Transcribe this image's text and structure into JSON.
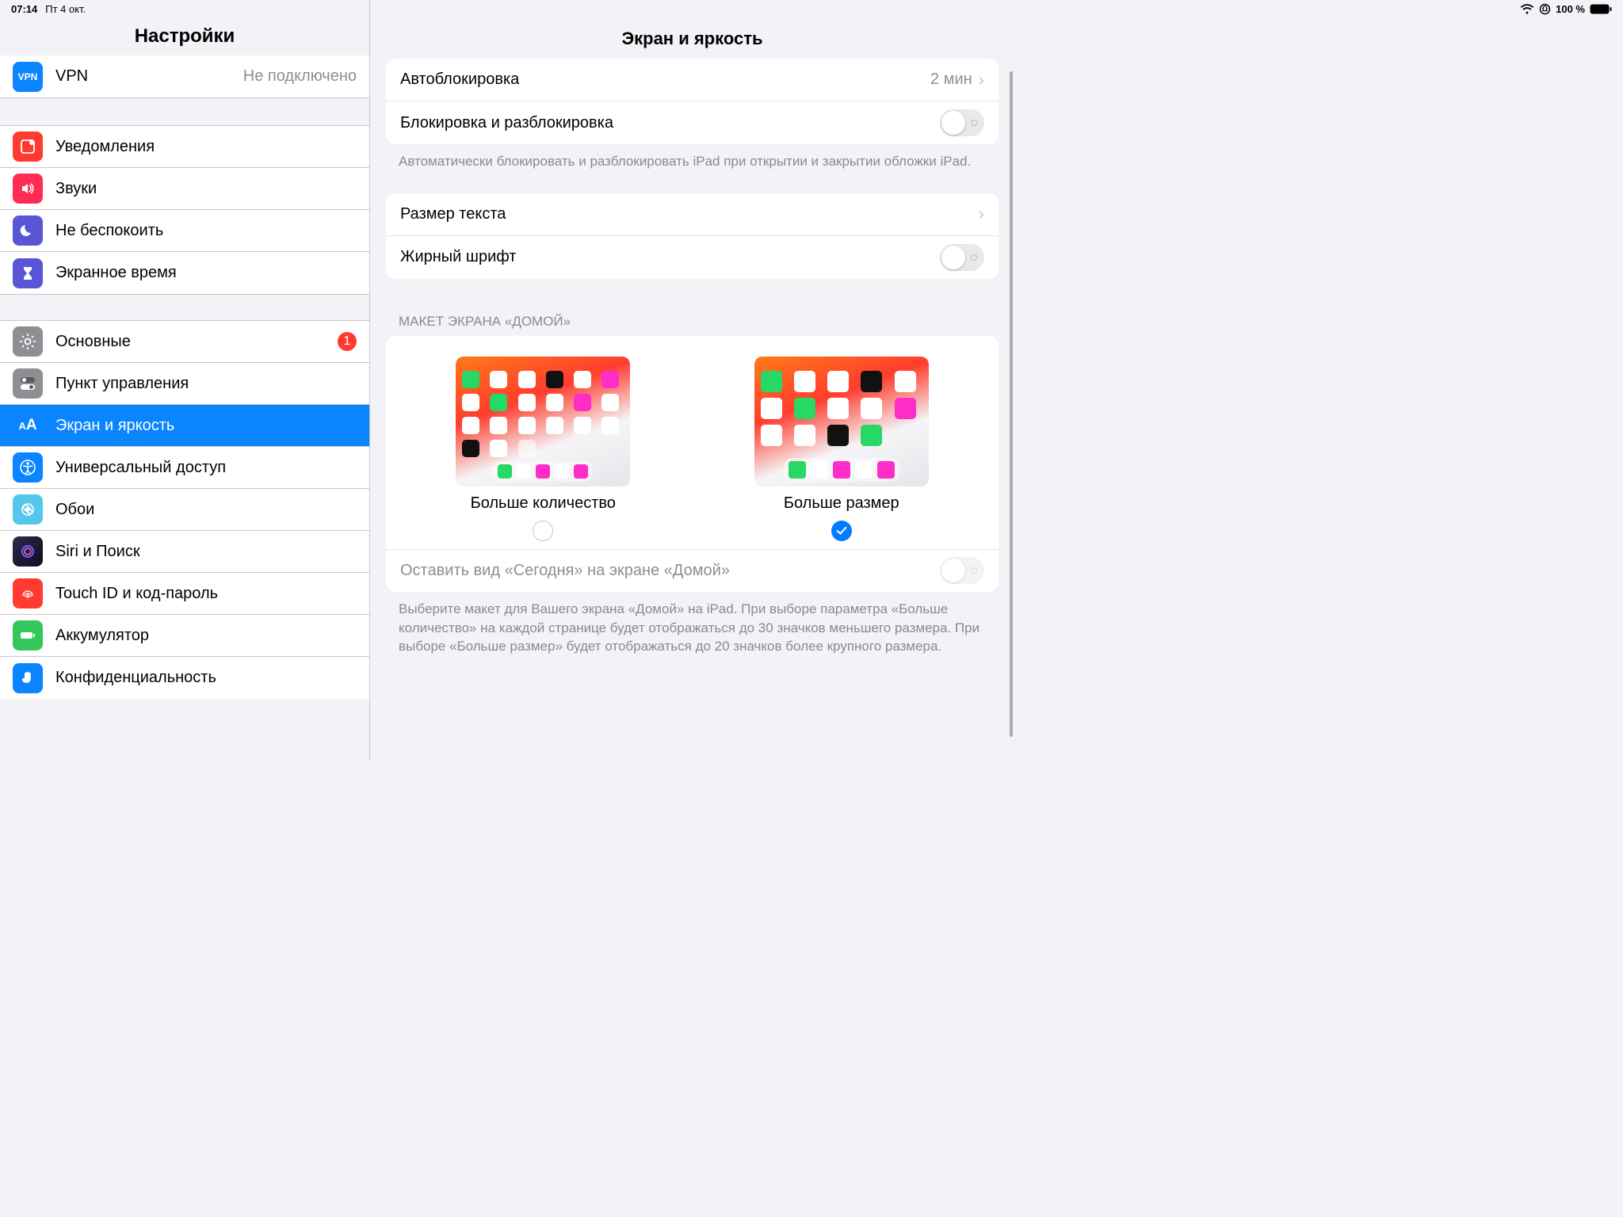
{
  "statusbar": {
    "time": "07:14",
    "date": "Пт 4 окт.",
    "battery": "100 %"
  },
  "sidebar": {
    "title": "Настройки",
    "vpn": {
      "label": "VPN",
      "value": "Не подключено"
    },
    "g1": [
      {
        "label": "Уведомления",
        "bg": "#ff3b30"
      },
      {
        "label": "Звуки",
        "bg": "#ff2d55"
      },
      {
        "label": "Не беспокоить",
        "bg": "#5856d6"
      },
      {
        "label": "Экранное время",
        "bg": "#5856d6"
      }
    ],
    "g2": [
      {
        "label": "Основные",
        "bg": "#8e8e93",
        "badge": "1"
      },
      {
        "label": "Пункт управления",
        "bg": "#8e8e93"
      },
      {
        "label": "Экран и яркость",
        "bg": "#0a84ff",
        "selected": true
      },
      {
        "label": "Универсальный доступ",
        "bg": "#0a84ff"
      },
      {
        "label": "Обои",
        "bg": "#54c7ec"
      },
      {
        "label": "Siri и Поиск",
        "bg": "#1c1c1e"
      },
      {
        "label": "Touch ID и код-пароль",
        "bg": "#ff3b30"
      },
      {
        "label": "Аккумулятор",
        "bg": "#34c759"
      },
      {
        "label": "Конфиденциальность",
        "bg": "#0a84ff"
      }
    ]
  },
  "detail": {
    "title": "Экран и яркость",
    "autolock": {
      "label": "Автоблокировка",
      "value": "2 мин"
    },
    "lockunlock": "Блокировка и разблокировка",
    "lockunlock_desc": "Автоматически блокировать и разблокировать iPad при открытии и закрытии обложки iPad.",
    "textsize": "Размер текста",
    "bold": "Жирный шрифт",
    "layout_header": "МАКЕТ ЭКРАНА «ДОМОЙ»",
    "opt_more": "Больше количество",
    "opt_big": "Больше размер",
    "today": "Оставить вид «Сегодня» на экране «Домой»",
    "layout_desc": "Выберите макет для Вашего экрана «Домой» на iPad. При выборе параметра «Больше количество» на каждой странице будет отображаться до 30 значков меньшего размера. При выборе «Больше размер» будет отображаться до 20 значков более крупного размера."
  }
}
